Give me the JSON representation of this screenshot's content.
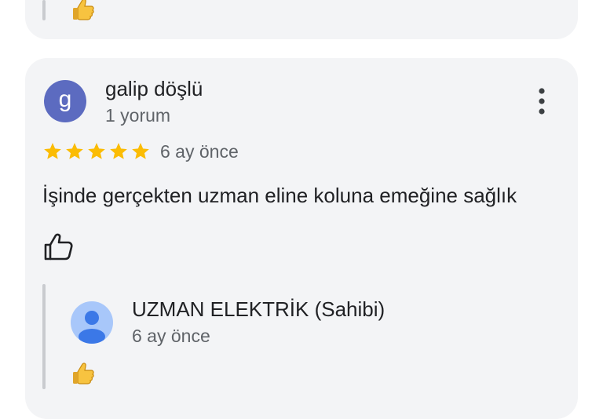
{
  "previous_review": {
    "like_icon": "thumbs-up-emoji-icon"
  },
  "review": {
    "avatar_letter": "g",
    "author": "galip döşlü",
    "review_count": "1 yorum",
    "rating": 5,
    "rating_max": 5,
    "time": "6 ay önce",
    "text": "İşinde gerçekten uzman eline koluna emeğine sağlık",
    "more_icon": "more-vert-icon",
    "like_icon": "thumbs-up-outline-icon",
    "avatar_color": "#5c6bc0",
    "star_color": "#fbbc04"
  },
  "owner_reply": {
    "name": "UZMAN ELEKTRİK (Sahibi)",
    "time": "6 ay önce",
    "avatar_icon": "person-icon",
    "avatar_color": "#a8c7fa",
    "like_icon": "thumbs-up-emoji-icon"
  }
}
